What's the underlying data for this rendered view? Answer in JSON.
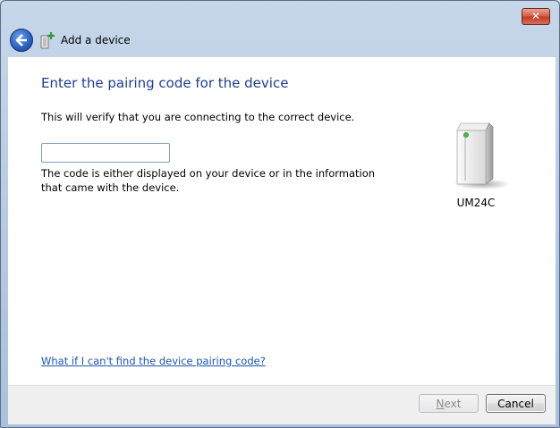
{
  "window": {
    "close_label": "✕",
    "title": "Add a device"
  },
  "icons": {
    "back": "back-arrow-icon",
    "wizard": "add-device-icon",
    "device": "device-tower-icon"
  },
  "main": {
    "heading": "Enter the pairing code for the device",
    "description": "This will verify that you are connecting to the correct device.",
    "code_value": "",
    "code_placeholder": "",
    "hint": "The code is either displayed on your device or in the information that came with the device.",
    "device_name": "UM24C",
    "help_link": "What if I can't find the device pairing code?"
  },
  "footer": {
    "next_first": "N",
    "next_rest": "ext",
    "cancel_label": "Cancel"
  },
  "colors": {
    "heading": "#1e3f8f",
    "link": "#1a56b4",
    "device_led": "#3fbf3f"
  }
}
